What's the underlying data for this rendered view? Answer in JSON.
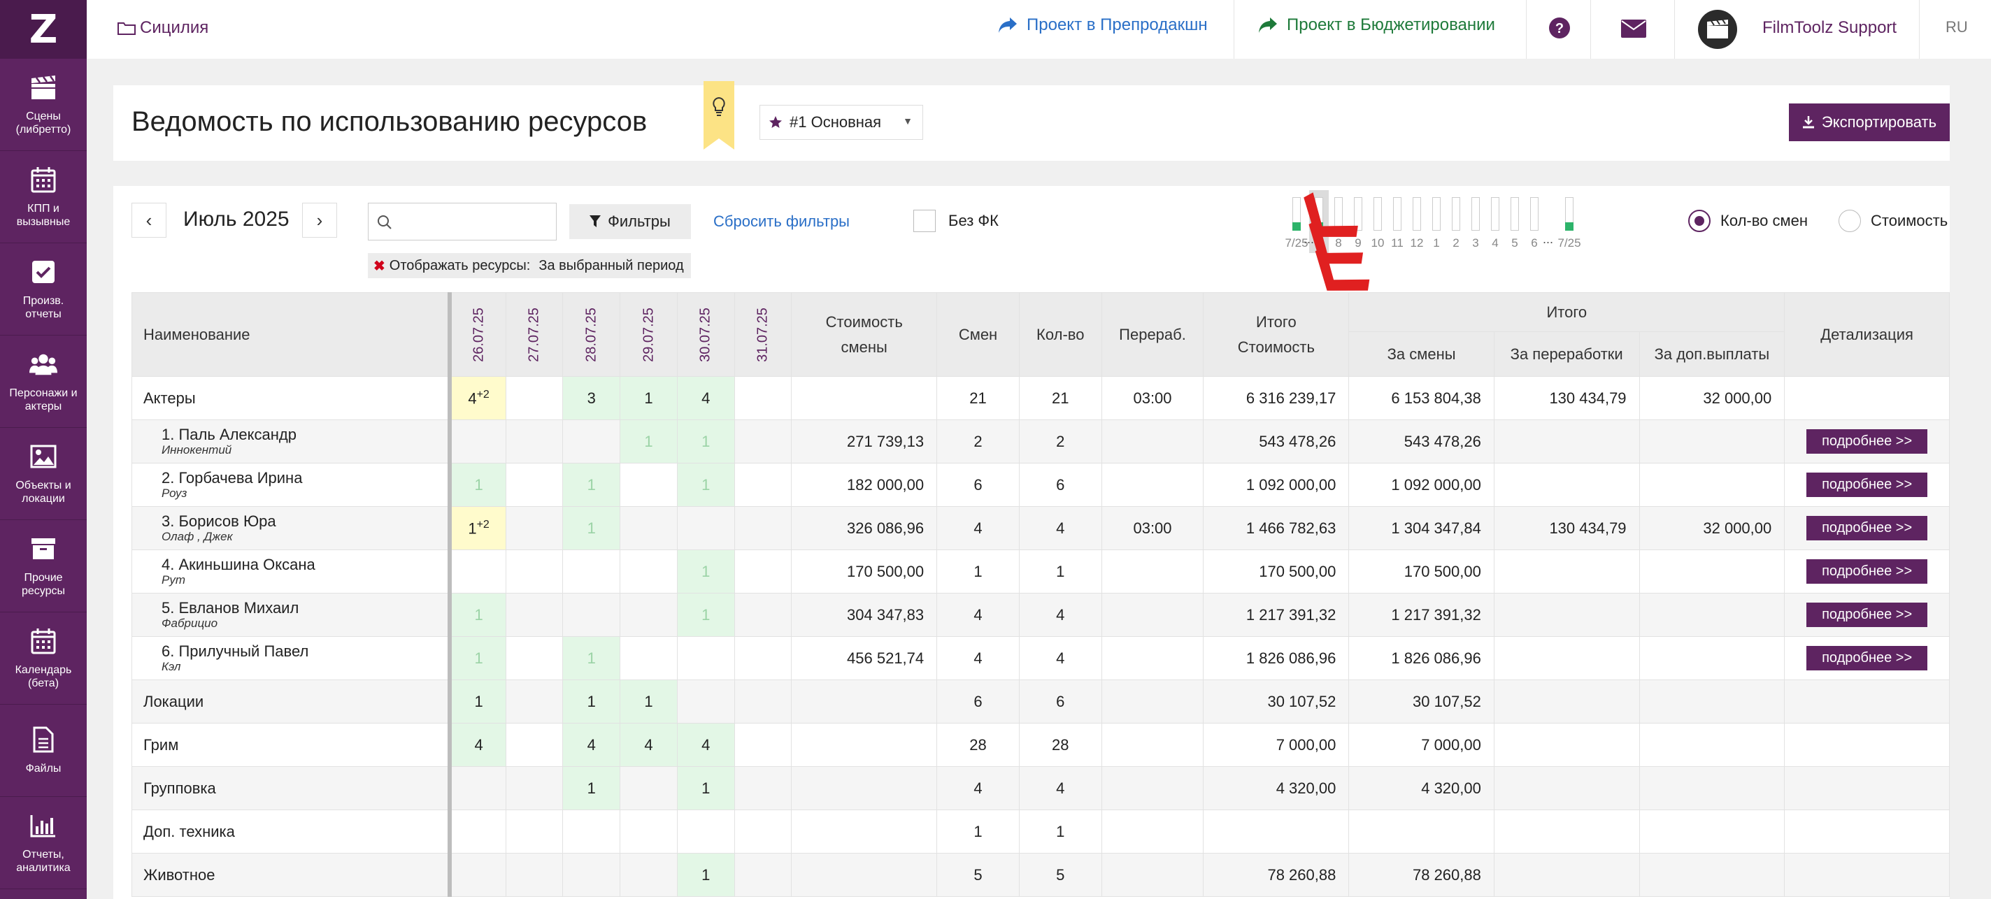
{
  "sidebar": {
    "logo": "Z",
    "items": [
      {
        "label": "Сцены (либретто)",
        "icon": "clapperboard-icon"
      },
      {
        "label": "КПП и вызывные",
        "icon": "calendar-icon"
      },
      {
        "label": "Произв. отчеты",
        "icon": "checkbox-icon"
      },
      {
        "label": "Персонажи и актеры",
        "icon": "people-icon"
      },
      {
        "label": "Объекты и локации",
        "icon": "image-icon"
      },
      {
        "label": "Прочие ресурсы",
        "icon": "box-icon"
      },
      {
        "label": "Календарь (бета)",
        "icon": "calendar-icon"
      },
      {
        "label": "Файлы",
        "icon": "file-icon"
      },
      {
        "label": "Отчеты, аналитика",
        "icon": "bar-chart-icon"
      }
    ]
  },
  "topbar": {
    "breadcrumb": "Сицилия",
    "link_preprod": "Проект в Препродакшн",
    "link_budget": "Проект в Бюджетировании",
    "user": "FilmToolz Support",
    "lang": "RU"
  },
  "header": {
    "title": "Ведомость по использованию ресурсов",
    "version": "#1 Основная",
    "export_label": "Экспортировать"
  },
  "toolbar": {
    "month": "Июль 2025",
    "prev": "‹",
    "next": "›",
    "search_placeholder": "",
    "filters_label": "Фильтры",
    "reset_label": "Сбросить фильтры",
    "nofk_label": "Без ФК",
    "chip_label": "Отображать ресурсы:",
    "chip_value": "За выбранный период",
    "radio_shifts": "Кол-во смен",
    "radio_cost": "Стоимость"
  },
  "timeline": {
    "labels": [
      "7/25",
      "7",
      "8",
      "9",
      "10",
      "11",
      "12",
      "1",
      "2",
      "3",
      "4",
      "5",
      "6",
      "7/25"
    ],
    "filled": [
      true,
      true,
      false,
      false,
      false,
      false,
      false,
      false,
      false,
      false,
      false,
      false,
      false,
      true
    ],
    "selected_index": 1,
    "dots": "..."
  },
  "table": {
    "headers": {
      "name": "Наименование",
      "dates": [
        "26.07.25",
        "27.07.25",
        "28.07.25",
        "29.07.25",
        "30.07.25",
        "31.07.25"
      ],
      "shift_cost": "Стоимость смены",
      "shifts": "Смен",
      "qty": "Кол-во",
      "overtime": "Перераб.",
      "total_cost": "Итого Стоимость",
      "total_group": "Итого",
      "for_shifts": "За смены",
      "for_overtime": "За переработки",
      "for_extra": "За доп.выплаты",
      "details": "Детализация"
    },
    "detail_label": "подробнее >>",
    "rows": [
      {
        "name": "Актеры",
        "role": "",
        "sub": false,
        "days": [
          {
            "v": "4",
            "sup": "+2",
            "c": "y"
          },
          {
            "v": "",
            "c": ""
          },
          {
            "v": "3",
            "c": "g"
          },
          {
            "v": "1",
            "c": "g"
          },
          {
            "v": "4",
            "c": "g"
          },
          {
            "v": "",
            "c": ""
          }
        ],
        "shift_cost": "",
        "shifts": "21",
        "qty": "21",
        "overtime": "03:00",
        "total": "6 316 239,17",
        "for_shifts": "6 153 804,38",
        "for_overtime": "130 434,79",
        "for_extra": "32 000,00",
        "detail": false
      },
      {
        "name": "1. Паль Александр",
        "role": "Иннокентий",
        "sub": true,
        "days": [
          {
            "v": "",
            "c": "gray"
          },
          {
            "v": "",
            "c": "gray"
          },
          {
            "v": "",
            "c": "gray"
          },
          {
            "v": "1",
            "c": "g faint"
          },
          {
            "v": "1",
            "c": "g faint"
          },
          {
            "v": "",
            "c": ""
          }
        ],
        "shift_cost": "271 739,13",
        "shifts": "2",
        "qty": "2",
        "overtime": "",
        "total": "543 478,26",
        "for_shifts": "543 478,26",
        "for_overtime": "",
        "for_extra": "",
        "detail": true
      },
      {
        "name": "2. Горбачева Ирина",
        "role": "Роуз",
        "sub": true,
        "days": [
          {
            "v": "1",
            "c": "g faint"
          },
          {
            "v": "",
            "c": ""
          },
          {
            "v": "1",
            "c": "g faint"
          },
          {
            "v": "",
            "c": ""
          },
          {
            "v": "1",
            "c": "g faint"
          },
          {
            "v": "",
            "c": ""
          }
        ],
        "shift_cost": "182 000,00",
        "shifts": "6",
        "qty": "6",
        "overtime": "",
        "total": "1 092 000,00",
        "for_shifts": "1 092 000,00",
        "for_overtime": "",
        "for_extra": "",
        "detail": true
      },
      {
        "name": "3. Борисов Юра",
        "role": "Олаф , Джек",
        "sub": true,
        "days": [
          {
            "v": "1",
            "sup": "+2",
            "c": "y"
          },
          {
            "v": "",
            "c": "gray"
          },
          {
            "v": "1",
            "c": "g faint"
          },
          {
            "v": "",
            "c": "gray"
          },
          {
            "v": "",
            "c": "gray"
          },
          {
            "v": "",
            "c": ""
          }
        ],
        "shift_cost": "326 086,96",
        "shifts": "4",
        "qty": "4",
        "overtime": "03:00",
        "total": "1 466 782,63",
        "for_shifts": "1 304 347,84",
        "for_overtime": "130 434,79",
        "for_extra": "32 000,00",
        "detail": true
      },
      {
        "name": "4. Акиньшина Оксана",
        "role": "Рут",
        "sub": true,
        "days": [
          {
            "v": "",
            "c": ""
          },
          {
            "v": "",
            "c": ""
          },
          {
            "v": "",
            "c": ""
          },
          {
            "v": "",
            "c": ""
          },
          {
            "v": "1",
            "c": "g faint"
          },
          {
            "v": "",
            "c": ""
          }
        ],
        "shift_cost": "170 500,00",
        "shifts": "1",
        "qty": "1",
        "overtime": "",
        "total": "170 500,00",
        "for_shifts": "170 500,00",
        "for_overtime": "",
        "for_extra": "",
        "detail": true
      },
      {
        "name": "5. Евланов Михаил",
        "role": "Фабрицио",
        "sub": true,
        "days": [
          {
            "v": "1",
            "c": "g faint"
          },
          {
            "v": "",
            "c": "gray"
          },
          {
            "v": "",
            "c": "gray"
          },
          {
            "v": "",
            "c": "gray"
          },
          {
            "v": "1",
            "c": "g faint"
          },
          {
            "v": "",
            "c": ""
          }
        ],
        "shift_cost": "304 347,83",
        "shifts": "4",
        "qty": "4",
        "overtime": "",
        "total": "1 217 391,32",
        "for_shifts": "1 217 391,32",
        "for_overtime": "",
        "for_extra": "",
        "detail": true
      },
      {
        "name": "6. Прилучный Павел",
        "role": "Кэл",
        "sub": true,
        "days": [
          {
            "v": "1",
            "c": "g faint"
          },
          {
            "v": "",
            "c": ""
          },
          {
            "v": "1",
            "c": "g faint"
          },
          {
            "v": "",
            "c": ""
          },
          {
            "v": "",
            "c": ""
          },
          {
            "v": "",
            "c": ""
          }
        ],
        "shift_cost": "456 521,74",
        "shifts": "4",
        "qty": "4",
        "overtime": "",
        "total": "1 826 086,96",
        "for_shifts": "1 826 086,96",
        "for_overtime": "",
        "for_extra": "",
        "detail": true
      },
      {
        "name": "Локации",
        "role": "",
        "sub": false,
        "days": [
          {
            "v": "1",
            "c": "g"
          },
          {
            "v": "",
            "c": ""
          },
          {
            "v": "1",
            "c": "g"
          },
          {
            "v": "1",
            "c": "g"
          },
          {
            "v": "",
            "c": ""
          },
          {
            "v": "",
            "c": ""
          }
        ],
        "shift_cost": "",
        "shifts": "6",
        "qty": "6",
        "overtime": "",
        "total": "30 107,52",
        "for_shifts": "30 107,52",
        "for_overtime": "",
        "for_extra": "",
        "detail": false
      },
      {
        "name": "Грим",
        "role": "",
        "sub": false,
        "days": [
          {
            "v": "4",
            "c": "g"
          },
          {
            "v": "",
            "c": ""
          },
          {
            "v": "4",
            "c": "g"
          },
          {
            "v": "4",
            "c": "g"
          },
          {
            "v": "4",
            "c": "g"
          },
          {
            "v": "",
            "c": ""
          }
        ],
        "shift_cost": "",
        "shifts": "28",
        "qty": "28",
        "overtime": "",
        "total": "7 000,00",
        "for_shifts": "7 000,00",
        "for_overtime": "",
        "for_extra": "",
        "detail": false
      },
      {
        "name": "Групповка",
        "role": "",
        "sub": false,
        "days": [
          {
            "v": "",
            "c": ""
          },
          {
            "v": "",
            "c": ""
          },
          {
            "v": "1",
            "c": "g"
          },
          {
            "v": "",
            "c": ""
          },
          {
            "v": "1",
            "c": "g"
          },
          {
            "v": "",
            "c": ""
          }
        ],
        "shift_cost": "",
        "shifts": "4",
        "qty": "4",
        "overtime": "",
        "total": "4 320,00",
        "for_shifts": "4 320,00",
        "for_overtime": "",
        "for_extra": "",
        "detail": false
      },
      {
        "name": "Доп. техника",
        "role": "",
        "sub": false,
        "days": [
          {
            "v": "",
            "c": ""
          },
          {
            "v": "",
            "c": ""
          },
          {
            "v": "",
            "c": ""
          },
          {
            "v": "",
            "c": ""
          },
          {
            "v": "",
            "c": ""
          },
          {
            "v": "",
            "c": ""
          }
        ],
        "shift_cost": "",
        "shifts": "1",
        "qty": "1",
        "overtime": "",
        "total": "",
        "for_shifts": "",
        "for_overtime": "",
        "for_extra": "",
        "detail": false
      },
      {
        "name": "Животное",
        "role": "",
        "sub": false,
        "days": [
          {
            "v": "",
            "c": ""
          },
          {
            "v": "",
            "c": ""
          },
          {
            "v": "",
            "c": ""
          },
          {
            "v": "",
            "c": ""
          },
          {
            "v": "1",
            "c": "g"
          },
          {
            "v": "",
            "c": ""
          }
        ],
        "shift_cost": "",
        "shifts": "5",
        "qty": "5",
        "overtime": "",
        "total": "78 260,88",
        "for_shifts": "78 260,88",
        "for_overtime": "",
        "for_extra": "",
        "detail": false
      }
    ]
  },
  "colors": {
    "brand": "#5e2461",
    "green_cell": "#e3f7e6",
    "yellow_cell": "#fffbcc",
    "link_blue": "#2a6fc7",
    "link_green": "#1e7a3a",
    "arrow_red": "#e02020"
  }
}
